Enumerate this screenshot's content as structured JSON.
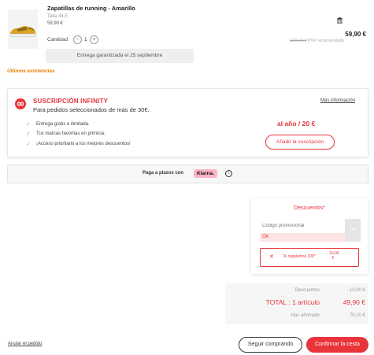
{
  "product": {
    "title": "Zapatillas de running - Amarillo",
    "size": "Talla 44,5",
    "unit_price": "59,90 €",
    "price": "59,90 €",
    "old_price": "120,00 €",
    "old_price_note": "PVP recomendado",
    "quantity_label": "Cantidad",
    "quantity": "1",
    "minus": "−",
    "plus": "+",
    "delivery": "Entrega garantizada el 25 septiembre",
    "stock_notice": "Últimos existencias"
  },
  "infinity": {
    "title": "SUSCRIPCIÓN INFINITY",
    "subtitle": "Para pedidos seleccionados de más de 30€.",
    "more_info": "Más información",
    "benefits": [
      "Entrega gratis e ilimitada.",
      "Tus marcas favoritas en primicia.",
      "¡Acceso prioritario a los mejores descuentos!"
    ],
    "price": "al año / 20 €",
    "add_button": "Añadir la suscripción"
  },
  "klarna": {
    "text": "Paga a plazos con",
    "logo": "Klarna.",
    "info": "i"
  },
  "discounts": {
    "title": "Descuentos*",
    "code_placeholder": "Código promocional",
    "ok_button": "OK",
    "ok_status": "OK",
    "gift_text": "Te regalamos 10€*",
    "gift_amount_top": "- 10,00",
    "gift_amount_bottom": "€"
  },
  "totals": {
    "discounts_label": "Descuentos",
    "discounts_value": "- 10,00 €",
    "total_label": "TOTAL : 1 artículo",
    "total_value": "49,90 €",
    "saved_label": "Has ahorrado",
    "saved_value": "70,10 €"
  },
  "footer": {
    "cancel": "Anular el pedido",
    "continue": "Seguir comprando",
    "confirm": "Confirmar la cesta"
  },
  "colors": {
    "accent": "#e8343a",
    "warning": "#f07b00",
    "klarna_pink": "#ffb3c7",
    "check_green": "#7bbf6a"
  }
}
